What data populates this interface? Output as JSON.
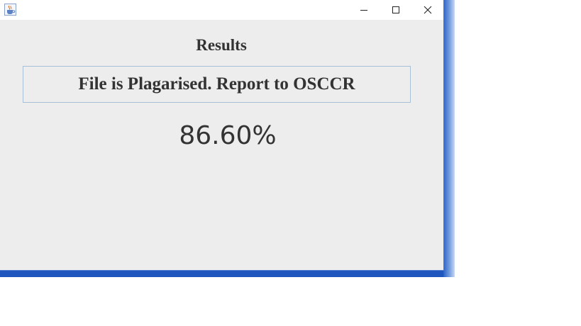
{
  "window": {
    "title": "",
    "controls": {
      "minimize_icon": "minimize-icon",
      "maximize_icon": "maximize-icon",
      "close_icon": "close-icon"
    },
    "app_icon": "java-coffee-cup-icon"
  },
  "results": {
    "heading": "Results",
    "verdict": "File is Plagarised. Report to OSCCR",
    "similarity": "86.60%"
  },
  "colors": {
    "window_bg": "#ededed",
    "titlebar_bg": "#ffffff",
    "box_border": "#a9bfd6",
    "text": "#333333",
    "desktop_blue": "#2e62c4"
  }
}
